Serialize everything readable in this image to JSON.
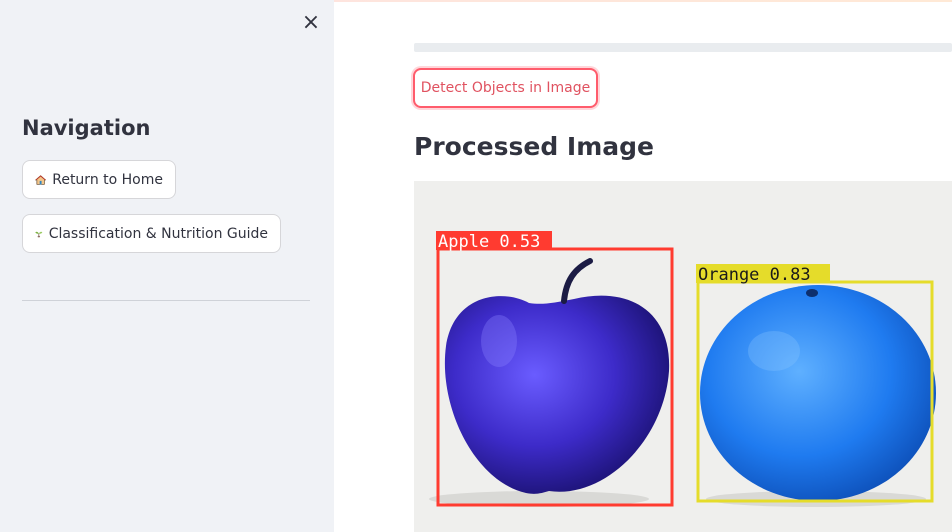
{
  "sidebar": {
    "close_glyph": "×",
    "title": "Navigation",
    "buttons": [
      {
        "label": "Return to Home",
        "icon": "house-icon"
      },
      {
        "label": "Classification & Nutrition Guide",
        "icon": "seedling-icon"
      }
    ]
  },
  "main": {
    "progress": 1.0,
    "detect_button": "Detect Objects in Image",
    "section_title": "Processed Image",
    "detections": [
      {
        "label": "Apple 0.53",
        "class": "Apple",
        "confidence": 0.53,
        "color": "#ff3b30"
      },
      {
        "label": "Orange 0.83",
        "class": "Orange",
        "confidence": 0.83,
        "color": "#e5dc2a"
      }
    ]
  },
  "colors": {
    "sidebar_bg": "#f0f2f6",
    "accent": "#ff5c6c",
    "text": "#31333f"
  }
}
